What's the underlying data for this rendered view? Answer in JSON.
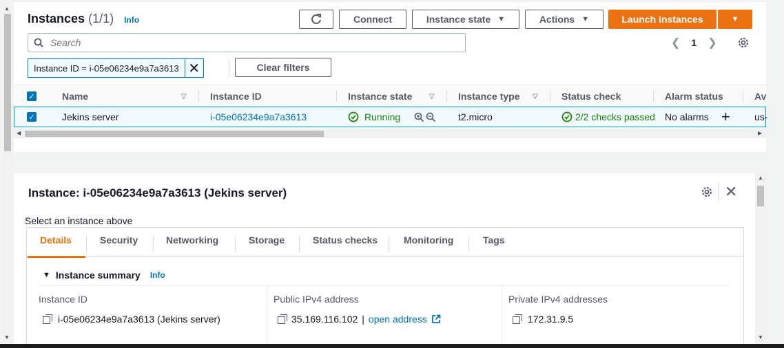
{
  "instances_panel": {
    "title": "Instances",
    "count": "(1/1)",
    "info": "Info",
    "refresh_icon": "refresh-icon",
    "buttons": {
      "connect": "Connect",
      "instance_state": "Instance state",
      "actions": "Actions",
      "launch": "Launch instances"
    },
    "search_placeholder": "Search",
    "pagination": {
      "page": "1"
    },
    "filter_token": "Instance ID = i-05e06234e9a7a3613",
    "clear_filters": "Clear filters",
    "columns": [
      "Name",
      "Instance ID",
      "Instance state",
      "Instance type",
      "Status check",
      "Alarm status",
      "Av"
    ],
    "rows": [
      {
        "name": "Jekins server",
        "instance_id": "i-05e06234e9a7a3613",
        "state": "Running",
        "type": "t2.micro",
        "status_check": "2/2 checks passed",
        "alarm_status": "No alarms",
        "az": "us-"
      }
    ]
  },
  "detail_panel": {
    "title": "Instance: i-05e06234e9a7a3613 (Jekins server)",
    "select_note": "Select an instance above",
    "tabs": [
      "Details",
      "Security",
      "Networking",
      "Storage",
      "Status checks",
      "Monitoring",
      "Tags"
    ],
    "active_tab": "Details",
    "summary": {
      "title": "Instance summary",
      "info": "Info"
    },
    "fields": [
      {
        "label": "Instance ID",
        "value": "i-05e06234e9a7a3613 (Jekins server)"
      },
      {
        "label": "Public IPv4 address",
        "value": "35.169.116.102",
        "sep": "|",
        "link": "open address"
      },
      {
        "label": "Private IPv4 addresses",
        "value": "172.31.9.5"
      }
    ]
  },
  "colors": {
    "accent": "#ec7211",
    "link": "#0073bb",
    "success": "#1d8102",
    "selected_row_bg": "#f1faff"
  }
}
